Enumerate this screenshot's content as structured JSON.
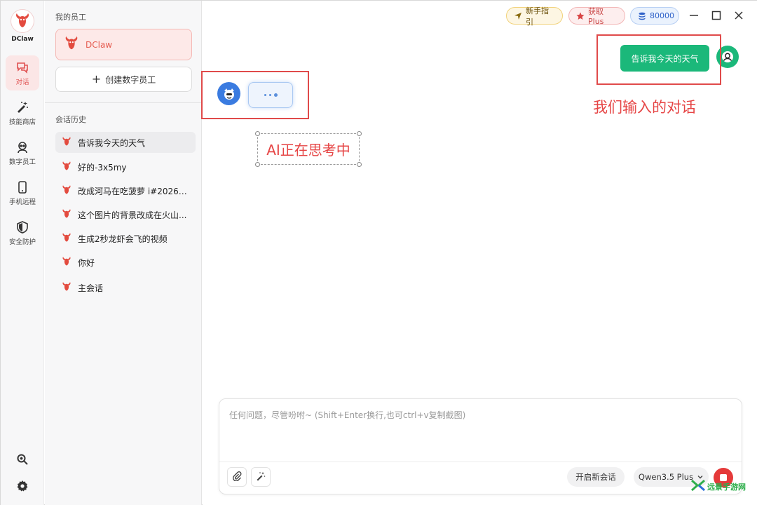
{
  "app": {
    "name": "DClaw"
  },
  "rail": {
    "items": [
      {
        "label": "对话",
        "icon": "chat-icon",
        "active": true
      },
      {
        "label": "技能商店",
        "icon": "magic-wand-icon"
      },
      {
        "label": "数字员工",
        "icon": "robot-icon"
      },
      {
        "label": "手机远程",
        "icon": "phone-icon"
      },
      {
        "label": "安全防护",
        "icon": "shield-icon"
      }
    ],
    "bottom_icons": [
      "zoom-search-icon",
      "gear-icon"
    ]
  },
  "panel": {
    "employees_title": "我的员工",
    "employee": {
      "name": "DClaw"
    },
    "create_label": "创建数字员工",
    "history_title": "会话历史",
    "history": [
      {
        "label": "告诉我今天的天气",
        "active": true
      },
      {
        "label": "好的-3x5my"
      },
      {
        "label": "改成河马在吃菠萝 i#202604..."
      },
      {
        "label": "这个图片的背景改成在火山..."
      },
      {
        "label": "生成2秒龙虾会飞的视频"
      },
      {
        "label": "你好"
      },
      {
        "label": "主会话"
      }
    ]
  },
  "topbar": {
    "guide_label": "新手指引",
    "plus_label": "获取Plus",
    "credits": "80000"
  },
  "chat": {
    "user_message": "告诉我今天的天气"
  },
  "annotations": {
    "user_input": "我们输入的对话",
    "ai_thinking": "AI正在思考中"
  },
  "input": {
    "placeholder": "任何问题，尽管吩咐~ (Shift+Enter换行,也可ctrl+v复制截图)",
    "new_chat_label": "开启新会话",
    "model": "Qwen3.5 Plus"
  },
  "watermark": {
    "text": "远景手游网"
  },
  "colors": {
    "accent_red": "#e05252",
    "user_bubble": "#1bb87a",
    "ai_avatar": "#3a7be0",
    "annotation": "#e04a4a"
  }
}
